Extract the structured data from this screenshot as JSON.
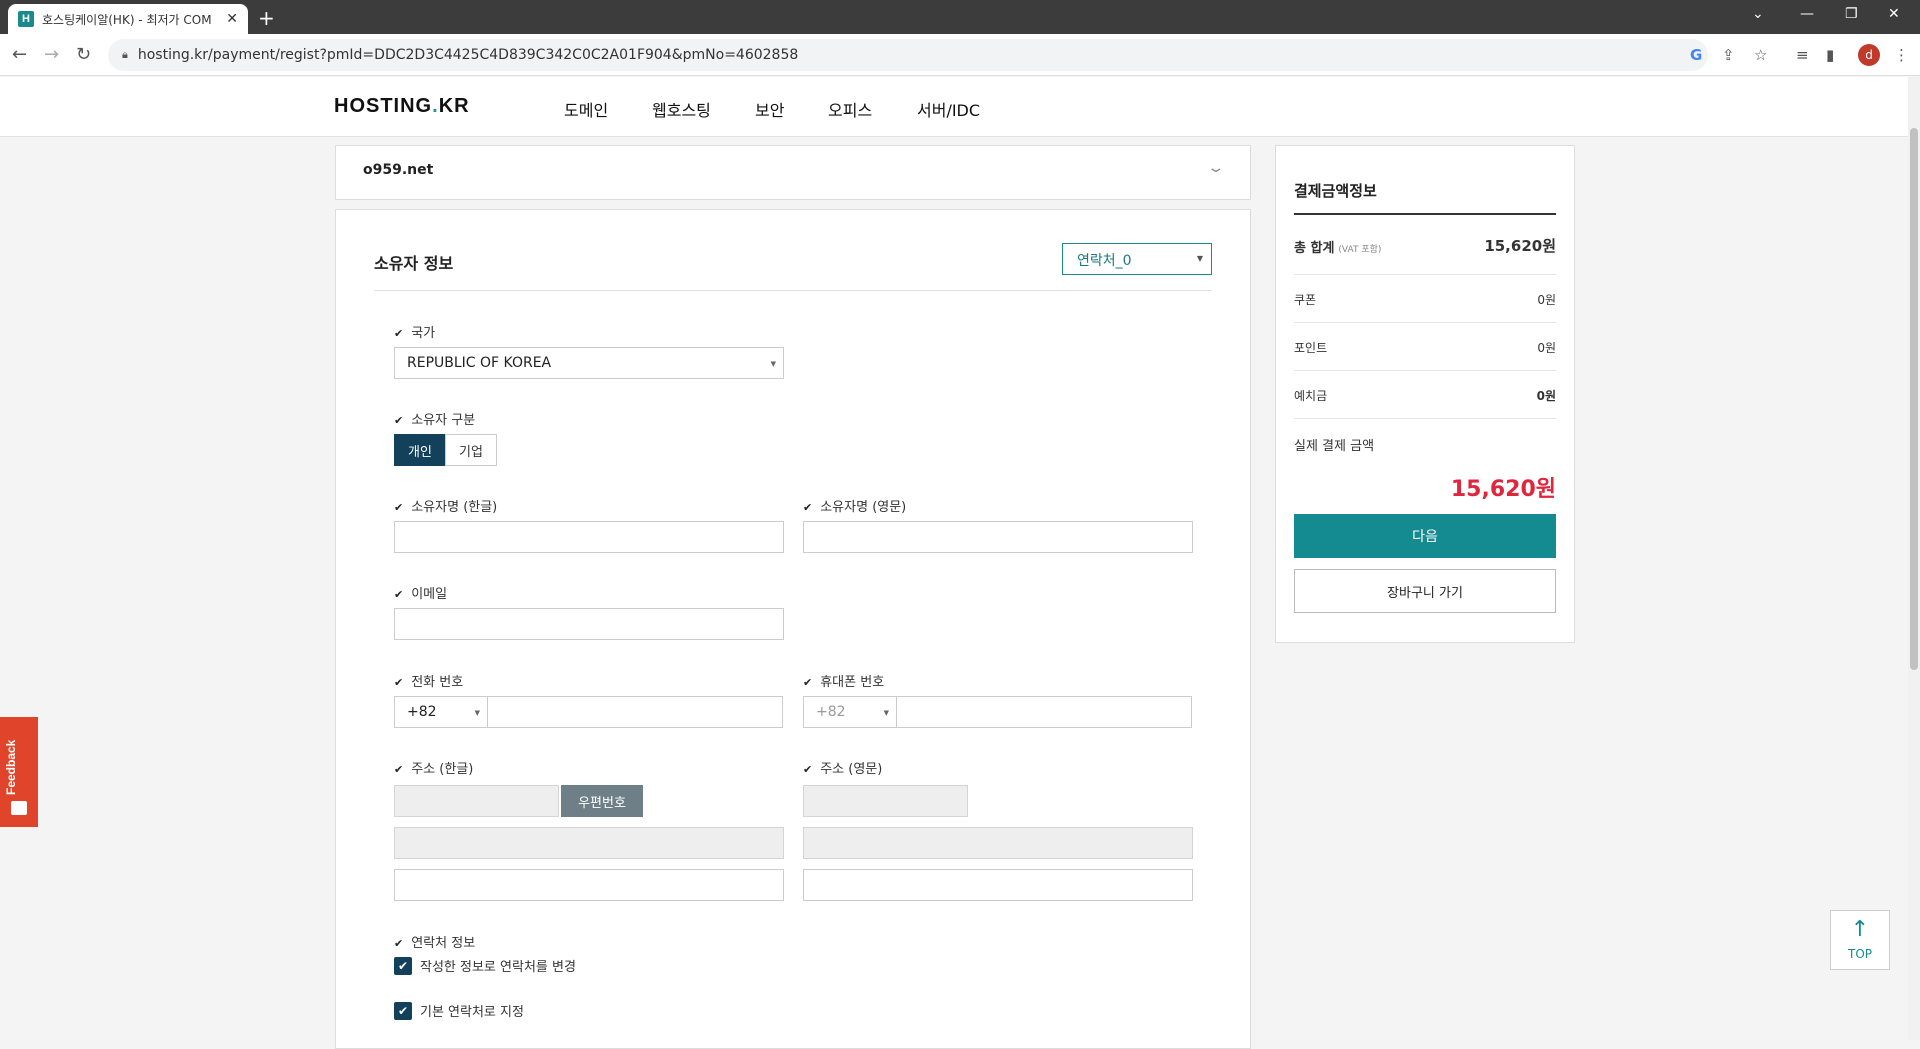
{
  "browser": {
    "tab_title": "호스팅케이알(HK) - 최저가 COM",
    "tab_favicon_letter": "H",
    "tab_close": "✕",
    "new_tab": "+",
    "url": "hosting.kr/payment/regist?pmId=DDC2D3C4425C4D839C342C0C2A01F904&pmNo=4602858",
    "profile_initial": "d"
  },
  "site": {
    "logo_part1": "HOSTING",
    "logo_dot": ".",
    "logo_part2": "KR",
    "nav": [
      "도메인",
      "웹호스팅",
      "보안",
      "오피스",
      "서버/IDC"
    ]
  },
  "domain_bar": {
    "name": "o959.net"
  },
  "owner_form": {
    "title": "소유자 정보",
    "contact_select": "연락처_0",
    "country_label": "국가",
    "country_value": "REPUBLIC OF KOREA",
    "owner_type_label": "소유자 구분",
    "owner_type_options": [
      "개인",
      "기업"
    ],
    "owner_type_selected": "개인",
    "name_kr_label": "소유자명 (한글)",
    "name_en_label": "소유자명 (영문)",
    "email_label": "이메일",
    "phone_label": "전화 번호",
    "phone_code": "+82",
    "mobile_label": "휴대폰 번호",
    "mobile_code": "+82",
    "address_kr_label": "주소 (한글)",
    "zipcode_button": "우편번호",
    "address_en_label": "주소 (영문)",
    "contact_info_label": "연락처 정보",
    "checkbox_update_contact": "작성한 정보로 연락처를 변경",
    "checkbox_default_contact": "기본 연락처로 지정"
  },
  "payment": {
    "title": "결제금액정보",
    "total_label": "총 합계",
    "total_vat_note": "(VAT 포함)",
    "total_value": "15,620원",
    "coupon_label": "쿠폰",
    "coupon_value": "0원",
    "point_label": "포인트",
    "point_value": "0원",
    "deposit_label": "예치금",
    "deposit_value": "0원",
    "real_amount_label": "실제 결제 금액",
    "real_amount_value": "15,620원",
    "next_button": "다음",
    "cart_button": "장바구니 가기"
  },
  "floating": {
    "feedback": "Feedback",
    "top_button": "TOP"
  },
  "colors": {
    "accent": "#138b91",
    "navy": "#13405a",
    "price_red": "#e0263c",
    "feedback_orange": "#e0452b"
  }
}
